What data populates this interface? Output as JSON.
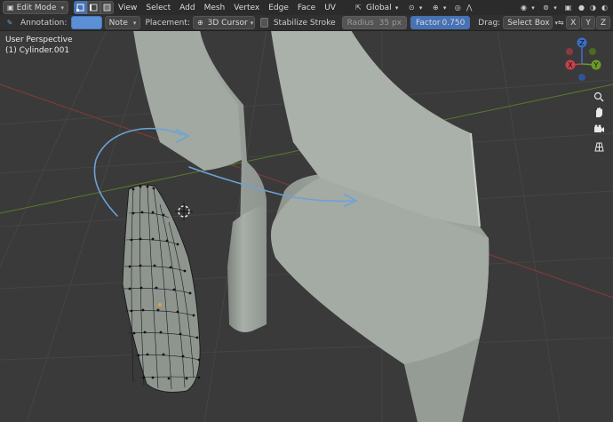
{
  "header": {
    "mode": "Edit Mode",
    "menus": [
      "View",
      "Select",
      "Add",
      "Mesh",
      "Vertex",
      "Edge",
      "Face",
      "UV"
    ],
    "transform_orientation": "Global"
  },
  "tool_settings": {
    "annotation_label": "Annotation:",
    "annotation_color": "#5b8fd6",
    "note": "Note",
    "placement_label": "Placement:",
    "placement": "3D Cursor",
    "stabilize_stroke": "Stabilize Stroke",
    "radius_label": "Radius",
    "radius_value": "35 px",
    "factor_label": "Factor",
    "factor_value": "0.750",
    "drag_label": "Drag:",
    "drag_value": "Select Box",
    "axes": [
      "X",
      "Y",
      "Z"
    ]
  },
  "viewport": {
    "perspective": "User Perspective",
    "object_name": "(1) Cylinder.001",
    "gizmo": {
      "x": "X",
      "y": "Y",
      "z": "Z"
    }
  },
  "colors": {
    "background": "#3a3a3a",
    "mesh": "#9aa09a",
    "annotation": "#6ba3d8",
    "axis_x": "#c8414b",
    "axis_y": "#6b9a2a",
    "axis_z": "#3b6ec8"
  },
  "icons": [
    "edit-mode-icon",
    "vertex-select-icon",
    "edge-select-icon",
    "face-select-icon",
    "orientation-icon",
    "pivot-icon",
    "snap-icon",
    "proportional-icon",
    "falloff-icon",
    "overlay-icon",
    "shading-icon",
    "hand-icon",
    "camera-icon",
    "grid-icon",
    "pencil-icon"
  ]
}
